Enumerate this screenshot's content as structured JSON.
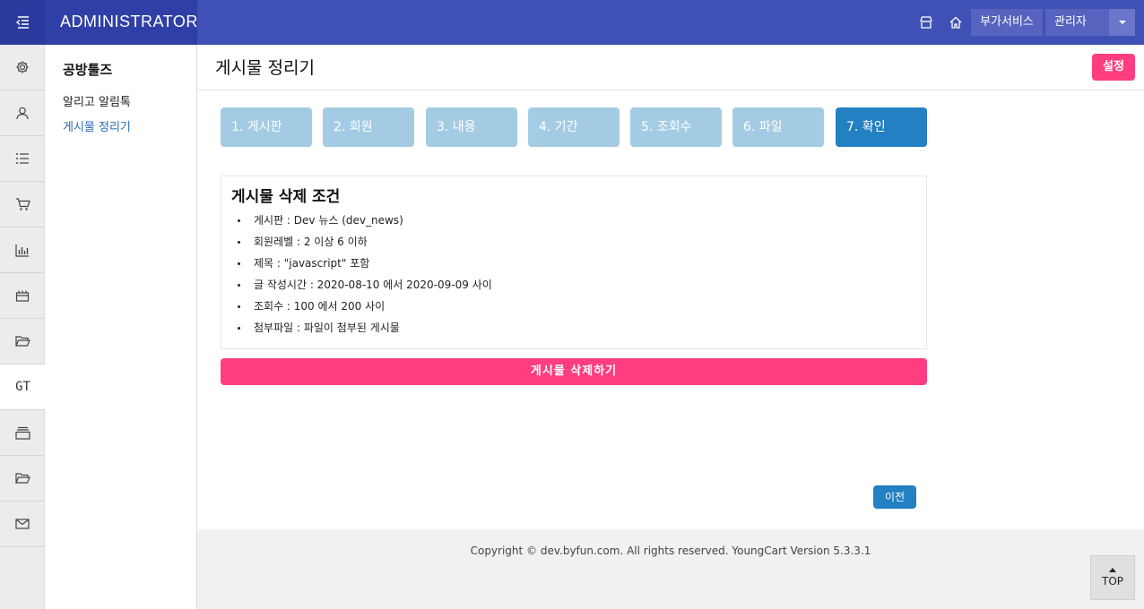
{
  "header": {
    "brand": "ADMINISTRATOR",
    "addon_label": "부가서비스",
    "admin_label": "관리자",
    "icons": [
      "menu-collapse-icon",
      "shop-icon",
      "home-icon",
      "caret-down-icon"
    ],
    "color": "#3f51b5"
  },
  "rail": {
    "items": [
      {
        "name": "settings",
        "icon": "gear-icon"
      },
      {
        "name": "members",
        "icon": "user-icon"
      },
      {
        "name": "board",
        "icon": "list-icon"
      },
      {
        "name": "shop",
        "icon": "cart-icon"
      },
      {
        "name": "stats",
        "icon": "bar-chart-icon"
      },
      {
        "name": "shop-setting",
        "icon": "store-icon"
      },
      {
        "name": "folder",
        "icon": "folder-open-icon"
      },
      {
        "name": "gt",
        "text": "GT",
        "active": true
      },
      {
        "name": "archive",
        "icon": "archive-icon"
      },
      {
        "name": "folder-2",
        "icon": "folder-open-icon"
      },
      {
        "name": "mail",
        "icon": "mail-icon"
      }
    ]
  },
  "subnav": {
    "title": "공방툴즈",
    "links": [
      {
        "label": "알리고 알림톡",
        "active": false
      },
      {
        "label": "게시물 정리기",
        "active": true
      }
    ]
  },
  "main": {
    "title": "게시물 정리기",
    "settings_label": "설정",
    "steps": [
      {
        "label": "1. 게시판",
        "active": false
      },
      {
        "label": "2. 회원",
        "active": false
      },
      {
        "label": "3. 내용",
        "active": false
      },
      {
        "label": "4. 기간",
        "active": false
      },
      {
        "label": "5. 조회수",
        "active": false
      },
      {
        "label": "6. 파일",
        "active": false
      },
      {
        "label": "7. 확인",
        "active": true
      }
    ],
    "conditions": {
      "title": "게시물 삭제 조건",
      "items": [
        "게시판 : Dev 뉴스 (dev_news)",
        "회원레벨 : 2 이상 6 이하",
        "제목 : \"javascript\" 포함",
        "글 작성시간 : 2020-08-10 에서 2020-09-09 사이",
        "조회수 : 100 에서 200 사이",
        "첨부파일 : 파일이 첨부된 게시물"
      ]
    },
    "delete_label": "게시물 삭제하기",
    "prev_label": "이전"
  },
  "footer": {
    "copyright": "Copyright © dev.byfun.com. All rights reserved. YoungCart Version 5.3.3.1",
    "top_label": "TOP"
  },
  "colors": {
    "accent": "#ff3d7f",
    "step_active": "#2380c2",
    "step_inactive": "#a4cbe4"
  }
}
